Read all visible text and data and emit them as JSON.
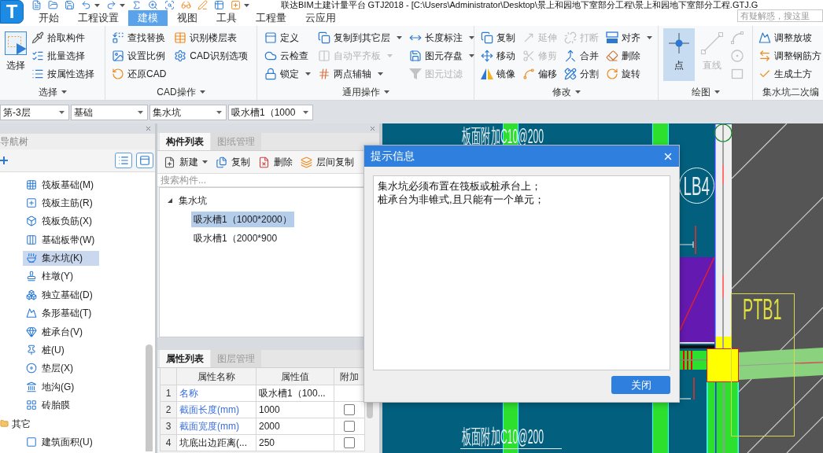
{
  "window": {
    "logo": "T",
    "title": "联达BIM土建计量平台 GTJ2018 - [C:\\Users\\Administrator\\Desktop\\景上和园地下室部分工程\\景上和园地下室部分工程.GTJ.G",
    "search": {
      "placeholder": "有疑解惑，搜这里"
    }
  },
  "menu_tabs": [
    {
      "label": "开始",
      "selected": false
    },
    {
      "label": "工程设置",
      "selected": false
    },
    {
      "label": "建模",
      "selected": true
    },
    {
      "label": "视图",
      "selected": false
    },
    {
      "label": "工具",
      "selected": false
    },
    {
      "label": "工程量",
      "selected": false
    },
    {
      "label": "云应用",
      "selected": false
    }
  ],
  "ribbon": [
    {
      "label": "选择",
      "menu": true,
      "columns": [
        [
          {
            "kind": "large",
            "label": "选择",
            "selected": false,
            "disabled": false
          }
        ],
        [
          {
            "kind": "small",
            "label": "拾取构件",
            "disabled": false,
            "menu": false
          },
          {
            "kind": "small",
            "label": "批量选择",
            "disabled": false,
            "menu": false
          },
          {
            "kind": "small",
            "label": "按属性选择",
            "disabled": false,
            "menu": false
          }
        ]
      ]
    },
    {
      "label": "CAD操作",
      "menu": true,
      "columns": [
        [
          {
            "kind": "small",
            "label": "查找替换",
            "disabled": false,
            "menu": false
          },
          {
            "kind": "small",
            "label": "设置比例",
            "disabled": false,
            "menu": false
          },
          {
            "kind": "small",
            "label": "还原CAD",
            "disabled": false,
            "menu": false
          }
        ],
        [
          {
            "kind": "small",
            "label": "识别楼层表",
            "disabled": false,
            "menu": false
          },
          {
            "kind": "small",
            "label": "CAD识别选项",
            "disabled": false,
            "menu": false
          }
        ]
      ]
    },
    {
      "label": "通用操作",
      "menu": true,
      "columns": [
        [
          {
            "kind": "small",
            "label": "定义",
            "disabled": false,
            "menu": false
          },
          {
            "kind": "small",
            "label": "云检查",
            "disabled": false,
            "menu": false
          },
          {
            "kind": "small",
            "label": "锁定",
            "disabled": false,
            "menu": true
          }
        ],
        [
          {
            "kind": "small",
            "label": "复制到其它层",
            "disabled": false,
            "menu": true
          },
          {
            "kind": "small",
            "label": "自动平齐板",
            "disabled": true,
            "menu": true
          },
          {
            "kind": "small",
            "label": "两点辅轴",
            "disabled": false,
            "menu": true
          }
        ],
        [
          {
            "kind": "small",
            "label": "长度标注",
            "disabled": false,
            "menu": true
          },
          {
            "kind": "small",
            "label": "图元存盘",
            "disabled": false,
            "menu": true
          },
          {
            "kind": "small",
            "label": "图元过滤",
            "disabled": true,
            "menu": false
          }
        ]
      ]
    },
    {
      "label": "修改",
      "menu": true,
      "columns": [
        [
          {
            "kind": "small",
            "label": "复制",
            "disabled": false,
            "menu": false
          },
          {
            "kind": "small",
            "label": "移动",
            "disabled": false,
            "menu": false
          },
          {
            "kind": "small",
            "label": "镜像",
            "disabled": false,
            "menu": false
          }
        ],
        [
          {
            "kind": "small",
            "label": "延伸",
            "disabled": true,
            "menu": false
          },
          {
            "kind": "small",
            "label": "修剪",
            "disabled": true,
            "menu": false
          },
          {
            "kind": "small",
            "label": "偏移",
            "disabled": false,
            "menu": false
          }
        ],
        [
          {
            "kind": "small",
            "label": "打断",
            "disabled": true,
            "menu": false
          },
          {
            "kind": "small",
            "label": "合并",
            "disabled": false,
            "menu": false
          },
          {
            "kind": "small",
            "label": "分割",
            "disabled": false,
            "menu": false
          }
        ],
        [
          {
            "kind": "small",
            "label": "对齐",
            "disabled": false,
            "menu": true
          },
          {
            "kind": "small",
            "label": "删除",
            "disabled": false,
            "menu": false
          },
          {
            "kind": "small",
            "label": "旋转",
            "disabled": false,
            "menu": false
          }
        ]
      ]
    },
    {
      "label": "绘图",
      "menu": true,
      "columns": [
        [
          {
            "kind": "large",
            "label": "点",
            "selected": true,
            "disabled": false
          }
        ],
        [
          {
            "kind": "large",
            "label": "直线",
            "selected": false,
            "disabled": true
          }
        ],
        [
          {
            "kind": "icon",
            "disabled": true
          },
          {
            "kind": "icon",
            "disabled": true
          },
          {
            "kind": "icon",
            "disabled": true
          }
        ]
      ]
    },
    {
      "label": "集水坑二次编",
      "menu": false,
      "columns": [
        [
          {
            "kind": "small",
            "label": "调整放坡",
            "disabled": false,
            "menu": false
          },
          {
            "kind": "small",
            "label": "调整钢筋方",
            "disabled": false,
            "menu": false
          },
          {
            "kind": "small",
            "label": "生成土方",
            "disabled": false,
            "menu": false
          }
        ]
      ]
    }
  ],
  "floor_bar": [
    {
      "value": "第-3层",
      "caret": true
    },
    {
      "value": "基础",
      "caret": true
    },
    {
      "value": "集水坑",
      "caret": true
    },
    {
      "value": "吸水槽1（1000",
      "caret": true
    }
  ],
  "nav_panel": {
    "title": "导航树",
    "tree": [
      {
        "children": [
          {
            "label": "筏板基础(M)",
            "selected": false
          },
          {
            "label": "筏板主筋(R)",
            "selected": false
          },
          {
            "label": "筏板负筋(X)",
            "selected": false
          },
          {
            "label": "基础板带(W)",
            "selected": false
          },
          {
            "label": "集水坑(K)",
            "selected": true
          },
          {
            "label": "柱墩(Y)",
            "selected": false
          },
          {
            "label": "独立基础(D)",
            "selected": false
          },
          {
            "label": "条形基础(T)",
            "selected": false
          },
          {
            "label": "桩承台(V)",
            "selected": false
          },
          {
            "label": "桩(U)",
            "selected": false
          },
          {
            "label": "垫层(X)",
            "selected": false
          },
          {
            "label": "地沟(G)",
            "selected": false
          },
          {
            "label": "砖胎膜",
            "selected": false
          }
        ]
      },
      {
        "label": "其它",
        "children": [
          {
            "label": "建筑面积(U)",
            "selected": false
          }
        ]
      }
    ]
  },
  "component_panel": {
    "tabs": [
      {
        "label": "构件列表",
        "selected": true
      },
      {
        "label": "图纸管理",
        "selected": false
      }
    ],
    "toolbar": [
      {
        "label": "新建",
        "menu": true
      },
      {
        "label": "复制",
        "menu": false
      },
      {
        "label": "删除",
        "menu": false
      },
      {
        "label": "层间复制",
        "menu": false
      }
    ],
    "search": {
      "placeholder": "搜索构件..."
    },
    "tree": [
      {
        "label": "集水坑",
        "expanded": true,
        "children": [
          {
            "label": "吸水槽1（1000*2000）",
            "selected": true
          },
          {
            "label": "吸水槽1（2000*900",
            "selected": false
          }
        ]
      }
    ]
  },
  "property_panel": {
    "tabs": [
      {
        "label": "属性列表",
        "selected": true
      },
      {
        "label": "图层管理",
        "selected": false
      }
    ],
    "columns": [
      "属性名称",
      "属性值",
      "附加"
    ],
    "rows": [
      {
        "index": "1",
        "name": "名称",
        "value": "吸水槽1（100...",
        "public": true
      },
      {
        "index": "2",
        "name": "截面长度(mm)",
        "value": "1000",
        "public": true,
        "checked": false
      },
      {
        "index": "3",
        "name": "截面宽度(mm)",
        "value": "2000",
        "public": true,
        "checked": false
      },
      {
        "index": "4",
        "name": "坑底出边距离(...",
        "value": "250",
        "public": false,
        "checked": false
      }
    ]
  },
  "canvas": {
    "labels": [
      {
        "kind": "note",
        "text": "板面附加C10@200"
      },
      {
        "kind": "note",
        "text": "板面附加C10@200"
      },
      {
        "kind": "tag",
        "text": "LB4"
      },
      {
        "kind": "zone",
        "text": "PTB1"
      }
    ]
  },
  "dialog": {
    "title": "提示信息",
    "message": [
      "集水坑必须布置在筏板或桩承台上；",
      "桩承台为非锥式,且只能有一个单元；"
    ],
    "button": "关闭"
  }
}
